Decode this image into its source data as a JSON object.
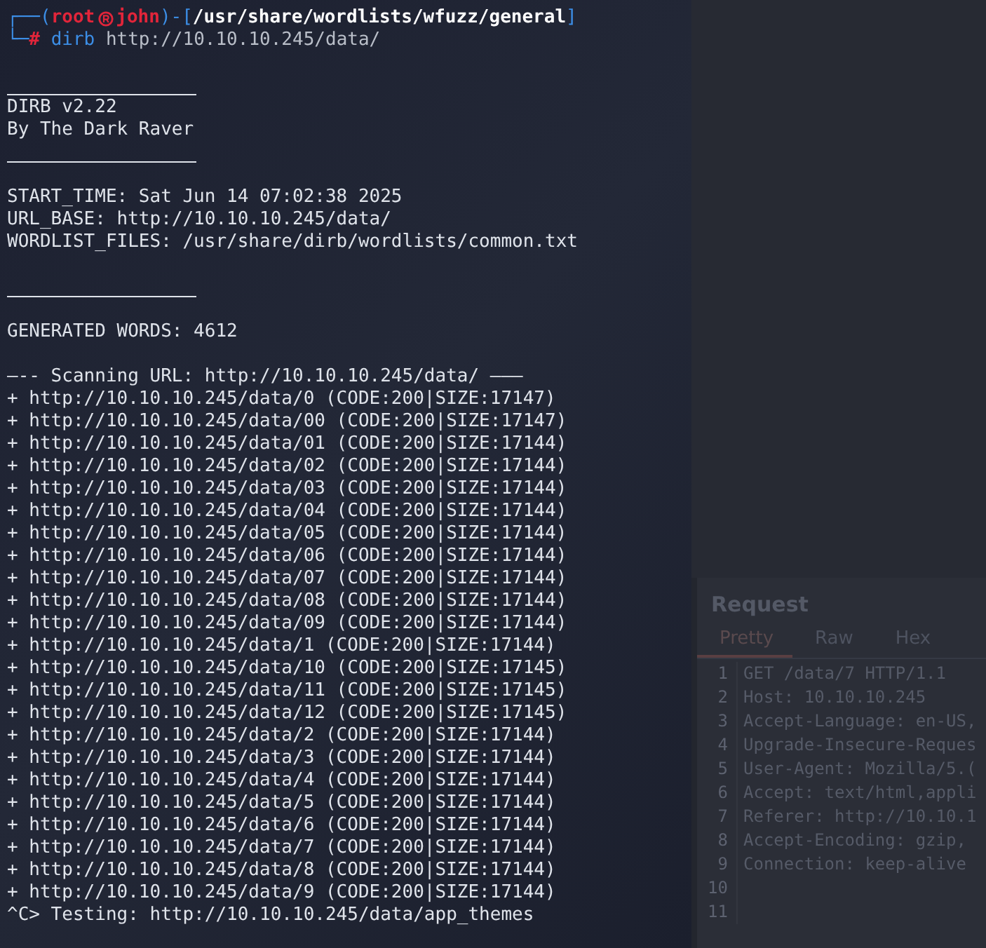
{
  "terminal": {
    "prompt": {
      "corner_top": "┌──(",
      "user": "root",
      "host": "john",
      "path_open": ")-[",
      "cwd": "/usr/share/wordlists/wfuzz/general",
      "path_close": "]",
      "corner_bottom": "└─",
      "symbol": "#",
      "command": "dirb",
      "argument": "http://10.10.10.245/data/"
    },
    "lines": [
      {
        "kind": "blank"
      },
      {
        "kind": "rule"
      },
      {
        "kind": "text",
        "text": "DIRB v2.22"
      },
      {
        "kind": "text",
        "text": "By The Dark Raver"
      },
      {
        "kind": "rule"
      },
      {
        "kind": "blank"
      },
      {
        "kind": "text",
        "text": "START_TIME: Sat Jun 14 07:02:38 2025"
      },
      {
        "kind": "text",
        "text": "URL_BASE: http://10.10.10.245/data/"
      },
      {
        "kind": "text",
        "text": "WORDLIST_FILES: /usr/share/dirb/wordlists/common.txt"
      },
      {
        "kind": "blank"
      },
      {
        "kind": "rule"
      },
      {
        "kind": "blank"
      },
      {
        "kind": "text",
        "text": "GENERATED WORDS: 4612"
      },
      {
        "kind": "blank"
      },
      {
        "kind": "text",
        "text": "—-- Scanning URL: http://10.10.10.245/data/ ———"
      },
      {
        "kind": "result",
        "text": "+ http://10.10.10.245/data/0 (CODE:200|SIZE:17147)"
      },
      {
        "kind": "result",
        "text": "+ http://10.10.10.245/data/00 (CODE:200|SIZE:17147)"
      },
      {
        "kind": "result",
        "text": "+ http://10.10.10.245/data/01 (CODE:200|SIZE:17144)"
      },
      {
        "kind": "result",
        "text": "+ http://10.10.10.245/data/02 (CODE:200|SIZE:17144)"
      },
      {
        "kind": "result",
        "text": "+ http://10.10.10.245/data/03 (CODE:200|SIZE:17144)"
      },
      {
        "kind": "result",
        "text": "+ http://10.10.10.245/data/04 (CODE:200|SIZE:17144)"
      },
      {
        "kind": "result",
        "text": "+ http://10.10.10.245/data/05 (CODE:200|SIZE:17144)"
      },
      {
        "kind": "result",
        "text": "+ http://10.10.10.245/data/06 (CODE:200|SIZE:17144)"
      },
      {
        "kind": "result",
        "text": "+ http://10.10.10.245/data/07 (CODE:200|SIZE:17144)"
      },
      {
        "kind": "result",
        "text": "+ http://10.10.10.245/data/08 (CODE:200|SIZE:17144)"
      },
      {
        "kind": "result",
        "text": "+ http://10.10.10.245/data/09 (CODE:200|SIZE:17144)"
      },
      {
        "kind": "result",
        "text": "+ http://10.10.10.245/data/1 (CODE:200|SIZE:17144)"
      },
      {
        "kind": "result",
        "text": "+ http://10.10.10.245/data/10 (CODE:200|SIZE:17145)"
      },
      {
        "kind": "result",
        "text": "+ http://10.10.10.245/data/11 (CODE:200|SIZE:17145)"
      },
      {
        "kind": "result",
        "text": "+ http://10.10.10.245/data/12 (CODE:200|SIZE:17145)"
      },
      {
        "kind": "result",
        "text": "+ http://10.10.10.245/data/2 (CODE:200|SIZE:17144)"
      },
      {
        "kind": "result",
        "text": "+ http://10.10.10.245/data/3 (CODE:200|SIZE:17144)"
      },
      {
        "kind": "result",
        "text": "+ http://10.10.10.245/data/4 (CODE:200|SIZE:17144)"
      },
      {
        "kind": "result",
        "text": "+ http://10.10.10.245/data/5 (CODE:200|SIZE:17144)"
      },
      {
        "kind": "result",
        "text": "+ http://10.10.10.245/data/6 (CODE:200|SIZE:17144)"
      },
      {
        "kind": "result",
        "text": "+ http://10.10.10.245/data/7 (CODE:200|SIZE:17144)"
      },
      {
        "kind": "result",
        "text": "+ http://10.10.10.245/data/8 (CODE:200|SIZE:17144)"
      },
      {
        "kind": "result",
        "text": "+ http://10.10.10.245/data/9 (CODE:200|SIZE:17144)"
      },
      {
        "kind": "text",
        "text": "^C> Testing: http://10.10.10.245/data/app_themes"
      }
    ]
  },
  "request_panel": {
    "title": "Request",
    "tabs": [
      {
        "label": "Pretty",
        "selected": true
      },
      {
        "label": "Raw",
        "selected": false
      },
      {
        "label": "Hex",
        "selected": false
      }
    ],
    "lines": [
      {
        "number": "1",
        "text": "GET /data/7 HTTP/1.1"
      },
      {
        "number": "2",
        "text": "Host: 10.10.10.245"
      },
      {
        "number": "3",
        "text": "Accept-Language: en-US,"
      },
      {
        "number": "4",
        "text": "Upgrade-Insecure-Reques"
      },
      {
        "number": "5",
        "text": "User-Agent: Mozilla/5.("
      },
      {
        "number": "6",
        "text": "Accept: text/html,appli"
      },
      {
        "number": "7",
        "text": "Referer: http://10.10.1"
      },
      {
        "number": "8",
        "text": "Accept-Encoding: gzip,"
      },
      {
        "number": "9",
        "text": "Connection: keep-alive"
      },
      {
        "number": "10"
      },
      {
        "number": "11"
      }
    ]
  }
}
